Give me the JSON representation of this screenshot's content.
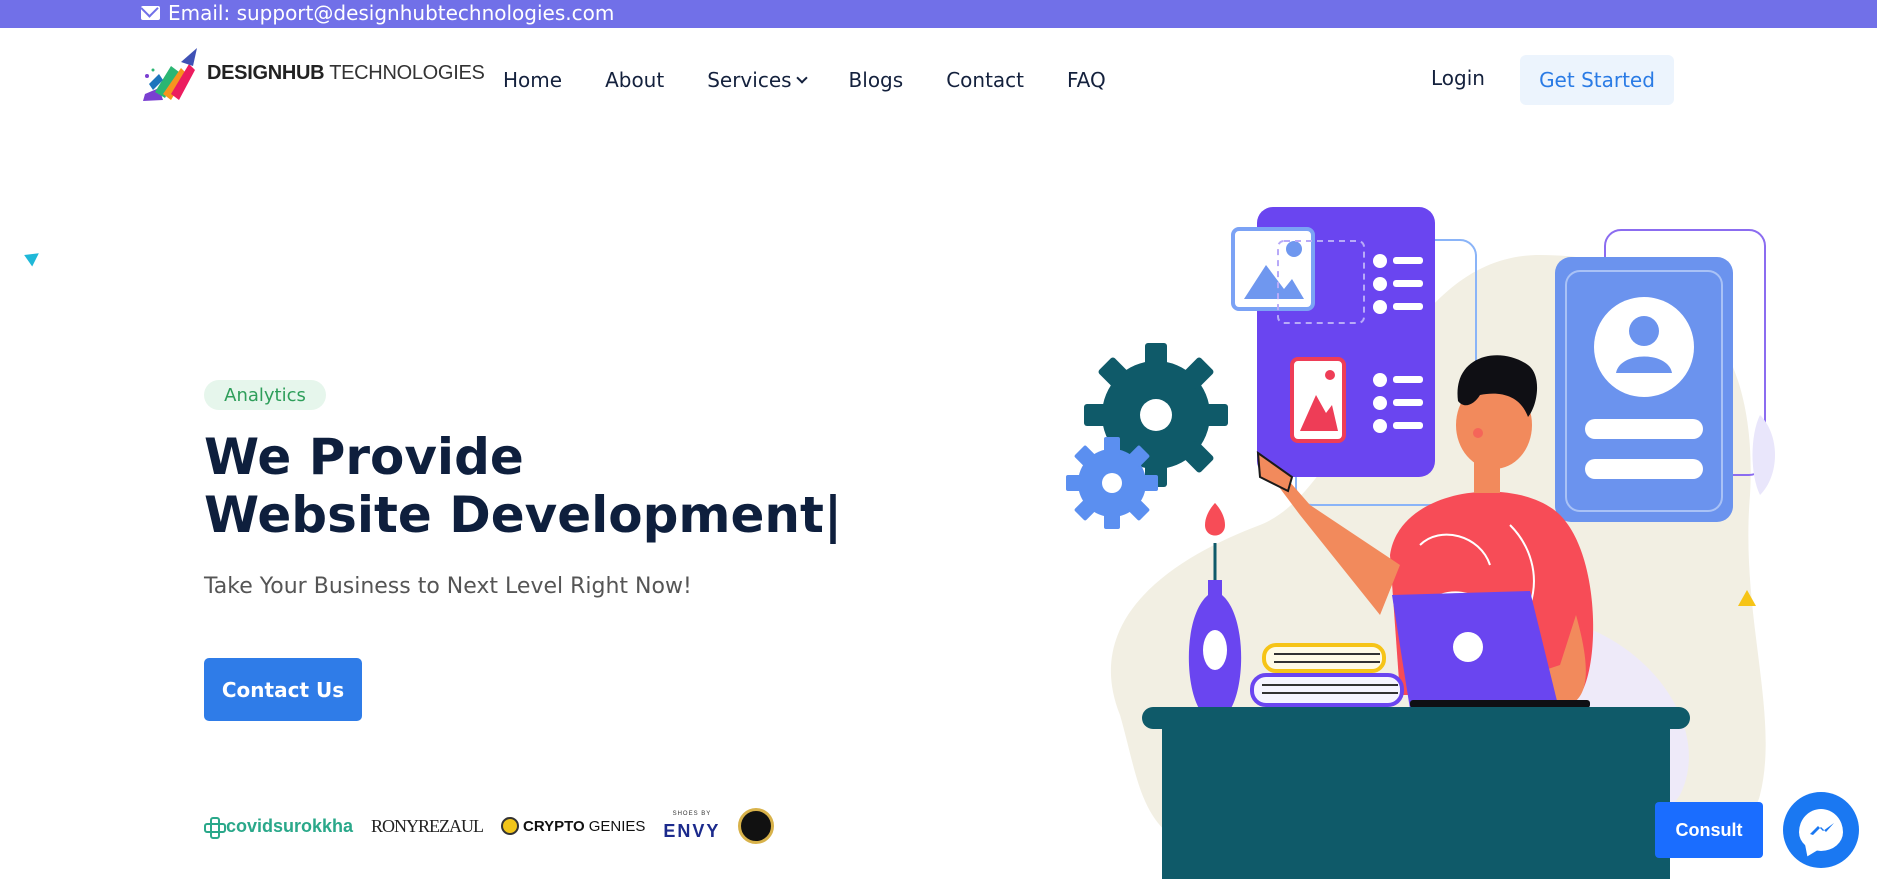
{
  "topbar": {
    "email_text": "Email: support@designhubtechnologies.com"
  },
  "brand": {
    "name_bold": "DESIGNHUB",
    "name_light": " TECHNOLOGIES"
  },
  "nav": {
    "items": [
      {
        "label": "Home"
      },
      {
        "label": "About"
      },
      {
        "label": "Services"
      },
      {
        "label": "Blogs"
      },
      {
        "label": "Contact"
      },
      {
        "label": "FAQ"
      }
    ],
    "login_label": "Login",
    "cta_label": "Get Started"
  },
  "hero": {
    "badge": "Analytics",
    "headline_line1": "We Provide",
    "headline_line2": "Website Development|",
    "subtitle": "Take Your Business to Next Level Right Now!",
    "cta_label": "Contact Us"
  },
  "clients": {
    "c1": "covidsurokkha",
    "c2": "RONYREZAUL",
    "c3_bold": "CRYPTO",
    "c3_light": "GENIES",
    "c4_small": "SHOES BY",
    "c4_big": "ENVY"
  },
  "widgets": {
    "consult_label": "Consult"
  },
  "colors": {
    "topbar": "#7170e8",
    "accent": "#2f7ce8",
    "headline": "#0e1f3d"
  },
  "icons": [
    "envelope-icon",
    "chevron-down-icon",
    "messenger-icon"
  ]
}
